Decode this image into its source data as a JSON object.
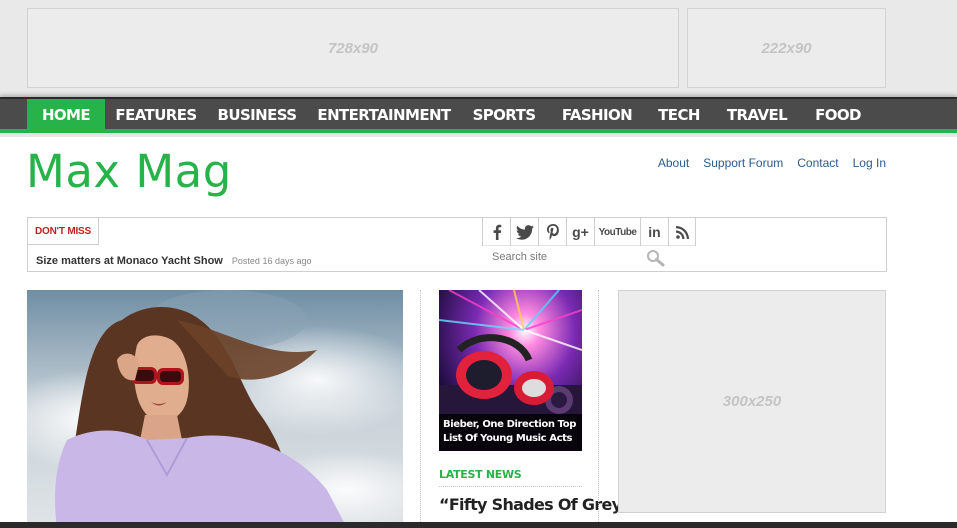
{
  "ads": {
    "leaderboard": "728x90",
    "small": "222x90",
    "sidebar": "300x250"
  },
  "nav": {
    "items": [
      {
        "label": "HOME",
        "active": true
      },
      {
        "label": "FEATURES"
      },
      {
        "label": "BUSINESS"
      },
      {
        "label": "ENTERTAINMENT"
      },
      {
        "label": "SPORTS"
      },
      {
        "label": "FASHION"
      },
      {
        "label": "TECH"
      },
      {
        "label": "TRAVEL"
      },
      {
        "label": "FOOD"
      }
    ]
  },
  "site": {
    "logo": "Max Mag"
  },
  "top_links": [
    "About",
    "Support Forum",
    "Contact",
    "Log In"
  ],
  "ticker": {
    "label": "DON'T MISS",
    "headline": "Size matters at Monaco Yacht Show",
    "posted": "Posted 16 days ago"
  },
  "social": {
    "icons": [
      "facebook-icon",
      "twitter-icon",
      "pinterest-icon",
      "google-plus-icon",
      "youtube-icon",
      "linkedin-icon",
      "rss-icon"
    ],
    "google_plus_text": "g+",
    "youtube_text": "YouTube",
    "linkedin_text": "in"
  },
  "search": {
    "placeholder": "Search site"
  },
  "featured": {
    "music_caption": "Bieber, One Direction Top List Of Young Music Acts",
    "latest_heading": "LATEST NEWS",
    "latest_story": "“Fifty Shades Of Grey”"
  },
  "colors": {
    "accent": "#27b34a",
    "nav_bg": "#4b4b4b",
    "ticker_label": "#c02020",
    "link": "#2b5b8a"
  }
}
